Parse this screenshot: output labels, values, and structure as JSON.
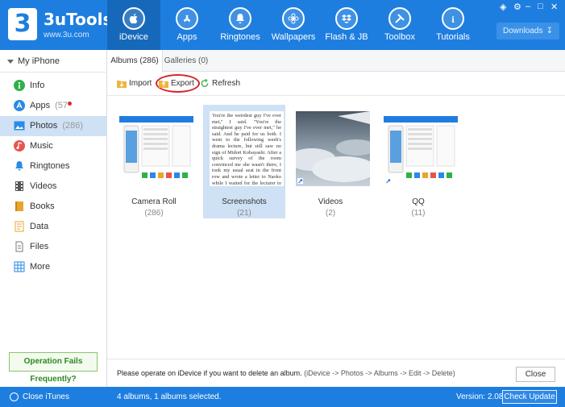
{
  "app": {
    "name": "3uTools",
    "url": "www.3u.com",
    "logo_glyph": "3"
  },
  "nav": {
    "tabs": [
      {
        "label": "iDevice",
        "icon": "apple-icon",
        "active": true
      },
      {
        "label": "Apps",
        "icon": "app-store-icon",
        "active": false
      },
      {
        "label": "Ringtones",
        "icon": "bell-icon",
        "active": false
      },
      {
        "label": "Wallpapers",
        "icon": "flower-icon",
        "active": false
      },
      {
        "label": "Flash & JB",
        "icon": "dropbox-icon",
        "active": false
      },
      {
        "label": "Toolbox",
        "icon": "wrench-icon",
        "active": false
      },
      {
        "label": "Tutorials",
        "icon": "info-icon",
        "active": false
      }
    ],
    "downloads_label": "Downloads",
    "window_controls": [
      "shirt-icon",
      "gear-icon",
      "minimize-icon",
      "maximize-icon",
      "close-icon"
    ]
  },
  "sidebar": {
    "device_label": "My iPhone",
    "items": [
      {
        "label": "Info",
        "icon": "info-circle-icon",
        "color": "#2fb14a",
        "count": ""
      },
      {
        "label": "Apps",
        "icon": "app-store-icon",
        "color": "#2a8ae6",
        "count": "57"
      },
      {
        "label": "Photos",
        "icon": "photo-icon",
        "color": "#2a8ae6",
        "count": "286"
      },
      {
        "label": "Music",
        "icon": "music-icon",
        "color": "#e8554d",
        "count": ""
      },
      {
        "label": "Ringtones",
        "icon": "bell-icon",
        "color": "#2a8ae6",
        "count": ""
      },
      {
        "label": "Videos",
        "icon": "film-icon",
        "color": "#555555",
        "count": ""
      },
      {
        "label": "Books",
        "icon": "book-icon",
        "color": "#e8a52b",
        "count": ""
      },
      {
        "label": "Data",
        "icon": "document-icon",
        "color": "#e8a52b",
        "count": ""
      },
      {
        "label": "Files",
        "icon": "file-icon",
        "color": "#777777",
        "count": ""
      },
      {
        "label": "More",
        "icon": "grid-icon",
        "color": "#2a8ae6",
        "count": ""
      }
    ],
    "apps_badge": "(57",
    "photos_badge": "(286)",
    "op_fails_label": "Operation Fails Frequently?"
  },
  "main": {
    "subtabs": [
      {
        "label": "Albums (286)",
        "active": true
      },
      {
        "label": "Galleries (0)",
        "active": false
      }
    ],
    "toolbar": {
      "import_label": "Import",
      "export_label": "Export",
      "refresh_label": "Refresh"
    },
    "albums": [
      {
        "name": "Camera Roll",
        "count": "(286)",
        "selected": false
      },
      {
        "name": "Screenshots",
        "count": "(21)",
        "selected": true
      },
      {
        "name": "Videos",
        "count": "(2)",
        "selected": false
      },
      {
        "name": "QQ",
        "count": "(11)",
        "selected": false
      }
    ],
    "screenshot_text": "You're the weirdest guy I've ever met,\" I said. \"You're the straightest guy I've ever met,\" he said. And he paid for us both. I went to the following week's drama lecture, but still saw no sign of Midori Kobayashi. After a quick survey of the room convinced me she wasn't there, I took my usual seat in the front row and wrote a letter to Naoko while I waited for the lecturer to arrive. I wrote about my summer travels – the roads I'd walked, the towns I'd passed through, the people I'd met. And every night I thought of you, I wrote. I realize how much I need you. Unconve",
    "footer_note": "Please operate on iDevice if you want to delete an album.",
    "footer_path": "(iDevice -> Photos -> Albums -> Edit -> Delete)",
    "close_label": "Close"
  },
  "status": {
    "close_itunes_label": "Close iTunes",
    "selection_info": "4 albums, 1 albums selected.",
    "version_label": "Version: 2.08",
    "check_update_label": "Check Update"
  }
}
